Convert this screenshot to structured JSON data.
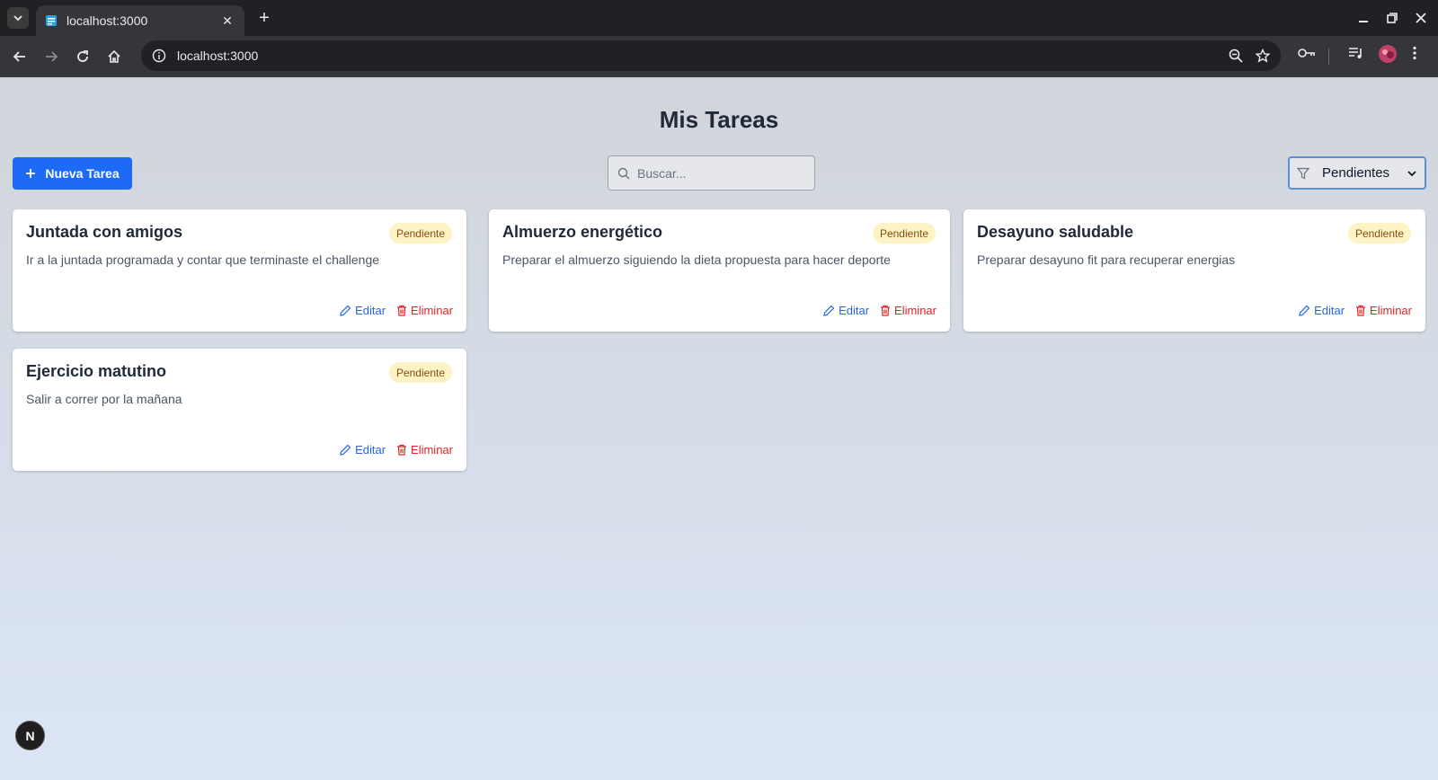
{
  "browser": {
    "tab_title": "localhost:3000",
    "url": "localhost:3000"
  },
  "page": {
    "title": "Mis Tareas",
    "new_task_label": "Nueva Tarea",
    "search_placeholder": "Buscar...",
    "filter_selected": "Pendientes",
    "dev_badge": "N"
  },
  "tasks": [
    {
      "title": "Juntada con amigos",
      "status": "Pendiente",
      "description": "Ir a la juntada programada y contar que terminaste el challenge",
      "edit_label": "Editar",
      "delete_label": "Eliminar"
    },
    {
      "title": "Almuerzo energético",
      "status": "Pendiente",
      "description": "Preparar el almuerzo siguiendo la dieta propuesta para hacer deporte",
      "edit_label": "Editar",
      "delete_label": "Eliminar"
    },
    {
      "title": "Desayuno saludable",
      "status": "Pendiente",
      "description": "Preparar desayuno fit para recuperar energias",
      "edit_label": "Editar",
      "delete_label": "Eliminar"
    },
    {
      "title": "Ejercicio matutino",
      "status": "Pendiente",
      "description": "Salir a correr por la mañana",
      "edit_label": "Editar",
      "delete_label": "Eliminar"
    }
  ],
  "colors": {
    "primary": "#1d6af7",
    "badge_bg": "#fdf3c4",
    "badge_text": "#854d0e",
    "edit": "#2563eb",
    "delete": "#dc2626"
  }
}
